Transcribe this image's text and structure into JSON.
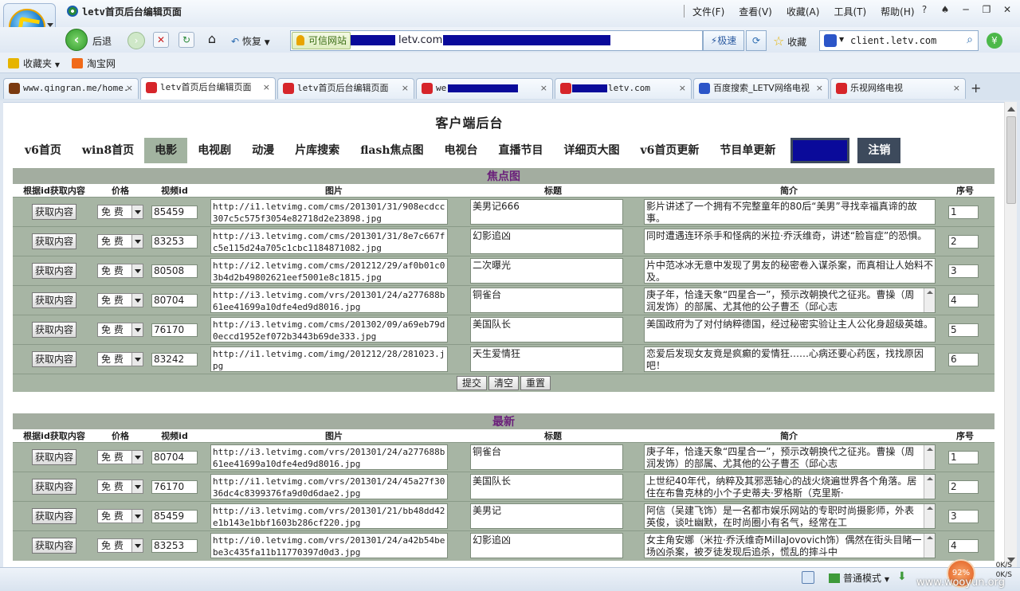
{
  "browser": {
    "window_title": "letv首页后台编辑页面",
    "menu": [
      "文件(F)",
      "查看(V)",
      "收藏(A)",
      "工具(T)",
      "帮助(H)"
    ],
    "back_label": "后退",
    "restore_label": "恢复",
    "trust_label": "可信网站",
    "address_visible": "letv.com",
    "speed_label": "极速",
    "favorites_label": "收藏",
    "search_value": "client.letv.com",
    "bookmarks": [
      "收藏夹",
      "淘宝网"
    ],
    "tabs": [
      {
        "label": "www.qingran.me/home."
      },
      {
        "label": "letv首页后台编辑页面"
      },
      {
        "label": "letv首页后台编辑页面"
      },
      {
        "label": "we"
      },
      {
        "label": "letv.com"
      },
      {
        "label": "百度搜索_LETV网络电视"
      },
      {
        "label": "乐视网络电视"
      }
    ]
  },
  "page": {
    "title": "客户端后台",
    "nav": [
      "v6首页",
      "win8首页",
      "电影",
      "电视剧",
      "动漫",
      "片库搜索",
      "flash焦点图",
      "电视台",
      "直播节目",
      "详细页大图",
      "v6首页更新",
      "节目单更新",
      "",
      "注销"
    ],
    "columns": [
      "根据id获取内容",
      "价格",
      "视频id",
      "图片",
      "标题",
      "简介",
      "序号"
    ],
    "fetch_label": "获取内容",
    "price_value": "免 费",
    "actions": [
      "提交",
      "清空",
      "重置"
    ],
    "sections": [
      {
        "title": "焦点图",
        "rows": [
          {
            "vid": "85459",
            "img": "http://i1.letvimg.com/cms/201301/31/908ecdcc307c5c575f3054e82718d2e23898.jpg",
            "title": "美男记666",
            "desc": "影片讲述了一个拥有不完整童年的80后“美男”寻找幸福真谛的故事。",
            "no": "1"
          },
          {
            "vid": "83253",
            "img": "http://i3.letvimg.com/cms/201301/31/8e7c667fc5e115d24a705c1cbc1184871082.jpg",
            "title": "幻影追凶",
            "desc": "同时遭遇连环杀手和怪病的米拉·乔沃维奇，讲述“脸盲症”的恐惧。",
            "no": "2"
          },
          {
            "vid": "80508",
            "img": "http://i2.letvimg.com/cms/201212/29/af0b01c03b4d2b49802621eef5001e8c1815.jpg",
            "title": "二次曝光",
            "desc": "片中范冰冰无意中发现了男友的秘密卷入谋杀案，而真相让人始料不及。",
            "no": "3"
          },
          {
            "vid": "80704",
            "img": "http://i3.letvimg.com/vrs/201301/24/a277688b61ee41699a10dfe4ed9d8016.jpg",
            "title": "铜雀台",
            "desc": "庚子年，恰逢天象“四星合一”，预示改朝换代之征兆。曹操（周润发饰）的部属、尤其他的公子曹丕（邱心志",
            "no": "4"
          },
          {
            "vid": "76170",
            "img": "http://i3.letvimg.com/cms/201302/09/a69eb79d0eccd1952ef072b3443b69de333.jpg",
            "title": "美国队长",
            "desc": "美国政府为了对付纳粹德国，经过秘密实验让主人公化身超级英雄。",
            "no": "5"
          },
          {
            "vid": "83242",
            "img": "http://i1.letvimg.com/img/201212/28/281023.jpg",
            "title": "天生爱情狂",
            "desc": "恋爱后发现女友竟是疯癫的爱情狂……心病还要心药医，找找原因吧！",
            "no": "6"
          }
        ]
      },
      {
        "title": "最新",
        "rows": [
          {
            "vid": "80704",
            "img": "http://i3.letvimg.com/vrs/201301/24/a277688b61ee41699a10dfe4ed9d8016.jpg",
            "title": "铜雀台",
            "desc": "庚子年，恰逢天象“四星合一”，预示改朝换代之征兆。曹操（周润发饰）的部属、尤其他的公子曹丕（邱心志",
            "no": "1"
          },
          {
            "vid": "76170",
            "img": "http://i1.letvimg.com/vrs/201301/24/45a27f3036dc4c8399376fa9d0d6dae2.jpg",
            "title": "美国队长",
            "desc": "上世纪40年代，纳粹及其邪恶轴心的战火烧遍世界各个角落。居住在布鲁克林的小个子史蒂夫·罗格斯（克里斯·",
            "no": "2"
          },
          {
            "vid": "85459",
            "img": "http://i3.letvimg.com/vrs/201301/21/bb48dd42e1b143e1bbf1603b286cf220.jpg",
            "title": "美男记",
            "desc": "阿信（吴建飞饰）是一名都市娱乐网站的专职时尚摄影师，外表英俊，谈吐幽默，在时尚圈小有名气，经常在工",
            "no": "3"
          },
          {
            "vid": "83253",
            "img": "http://i0.letvimg.com/vrs/201301/24/a42b54bebe3c435fa11b11770397d0d3.jpg",
            "title": "幻影追凶",
            "desc": "女主角安娜（米拉·乔沃维奇MillaJovovich饰）偶然在街头目睹一场凶杀案，被歹徒发现后追杀，慌乱的摔斗中",
            "no": "4"
          }
        ]
      }
    ]
  },
  "status": {
    "mode_label": "普通模式",
    "percent": "92%",
    "up_speed": "0K/S",
    "down_speed": "0K/S",
    "watermark": "www.wooyun.org"
  }
}
